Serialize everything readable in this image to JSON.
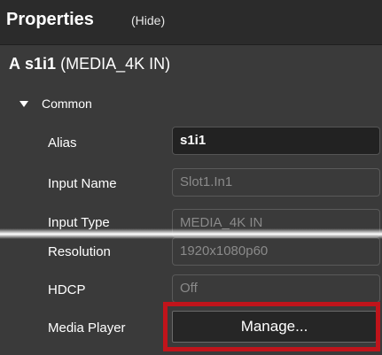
{
  "header": {
    "title": "Properties",
    "hide_label": "(Hide)"
  },
  "object": {
    "prefix": "A",
    "name": "s1i1",
    "type_label": "(MEDIA_4K IN)"
  },
  "section": {
    "label": "Common",
    "expanded": true
  },
  "rows": {
    "alias": {
      "label": "Alias",
      "value": "s1i1"
    },
    "input_name": {
      "label": "Input Name",
      "value": "Slot1.In1"
    },
    "input_type": {
      "label": "Input Type",
      "value": "MEDIA_4K IN"
    },
    "resolution": {
      "label": "Resolution",
      "value": "1920x1080p60"
    },
    "hdcp": {
      "label": "HDCP",
      "value": "Off"
    },
    "media_player": {
      "label": "Media Player",
      "button_label": "Manage..."
    }
  },
  "colors": {
    "background": "#3a3a3a",
    "header_background": "#2b2b2b",
    "highlight": "#c0141b",
    "readonly_text": "#8a8a8a"
  }
}
